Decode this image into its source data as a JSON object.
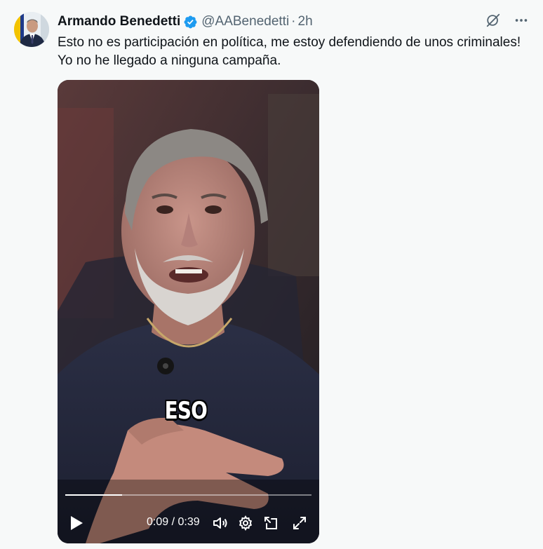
{
  "author": {
    "name": "Armando Benedetti",
    "handle": "@AABenedetti",
    "separator": "·",
    "time": "2h"
  },
  "tweet": {
    "lines": [
      "Esto no es participación en política, me estoy defendiendo de unos criminales!",
      "Yo no he llegado a ninguna campaña."
    ]
  },
  "video": {
    "caption": "ESO",
    "current_time": "0:09",
    "duration": "0:39",
    "time_separator": " / ",
    "progress": 0.231
  },
  "colors": {
    "verified": "#1d9bf0",
    "muted_text": "#536471",
    "background": "#f7f9f9"
  },
  "icons": {
    "verified": "verified-badge-icon",
    "grok": "grok-icon",
    "more": "more-options-icon",
    "play": "play-icon",
    "volume": "volume-icon",
    "settings": "settings-icon",
    "pip": "picture-in-picture-icon",
    "fullscreen": "fullscreen-icon"
  }
}
